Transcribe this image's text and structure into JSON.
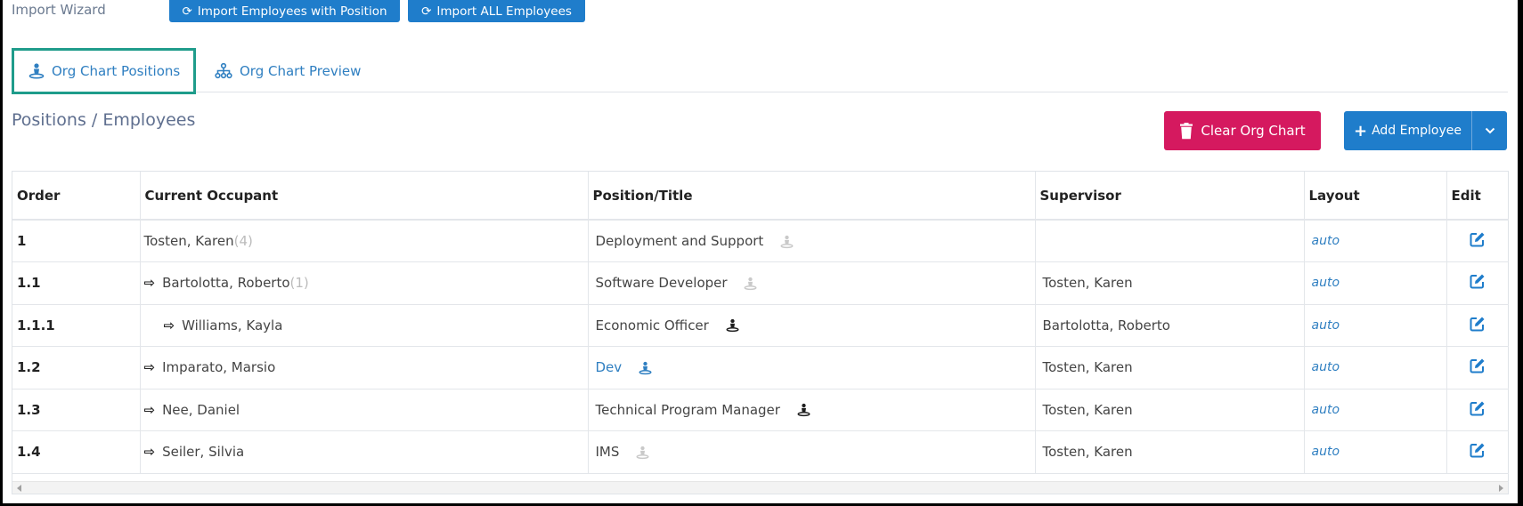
{
  "header": {
    "wizard_label": "Import Wizard",
    "import_with_position": "Import Employees with Position",
    "import_all": "Import ALL Employees"
  },
  "tabs": [
    {
      "label": "Org Chart Positions",
      "icon": "person-position-icon",
      "active": true
    },
    {
      "label": "Org Chart Preview",
      "icon": "org-chart-icon",
      "active": false
    }
  ],
  "section_title": "Positions / Employees",
  "actions": {
    "clear_label": "Clear Org Chart",
    "add_label": "Add Employee"
  },
  "colors": {
    "primary": "#1f7dcb",
    "danger": "#d5195f",
    "tab_active_border": "#1f9c8b",
    "link": "#2f7fc1"
  },
  "table": {
    "columns": [
      "Order",
      "Current Occupant",
      "Position/Title",
      "Supervisor",
      "Layout",
      "Edit"
    ],
    "rows": [
      {
        "order": "1",
        "occupant": "Tosten, Karen",
        "count": "(4)",
        "indent": 0,
        "position": "Deployment and Support",
        "position_icon": "faded",
        "supervisor": "",
        "layout": "auto"
      },
      {
        "order": "1.1",
        "occupant": "Bartolotta, Roberto",
        "count": "(1)",
        "indent": 1,
        "position": "Software Developer",
        "position_icon": "faded",
        "supervisor": "Tosten, Karen",
        "layout": "auto"
      },
      {
        "order": "1.1.1",
        "occupant": "Williams, Kayla",
        "count": "",
        "indent": 2,
        "position": "Economic Officer",
        "position_icon": "dark",
        "supervisor": "Bartolotta, Roberto",
        "layout": "auto"
      },
      {
        "order": "1.2",
        "occupant": "Imparato, Marsio",
        "count": "",
        "indent": 1,
        "position": "Dev",
        "position_icon": "blue",
        "supervisor": "Tosten, Karen",
        "layout": "auto"
      },
      {
        "order": "1.3",
        "occupant": "Nee, Daniel",
        "count": "",
        "indent": 1,
        "position": "Technical Program Manager",
        "position_icon": "dark",
        "supervisor": "Tosten, Karen",
        "layout": "auto"
      },
      {
        "order": "1.4",
        "occupant": "Seiler, Silvia",
        "count": "",
        "indent": 1,
        "position": "IMS",
        "position_icon": "faded",
        "supervisor": "Tosten, Karen",
        "layout": "auto"
      }
    ]
  }
}
